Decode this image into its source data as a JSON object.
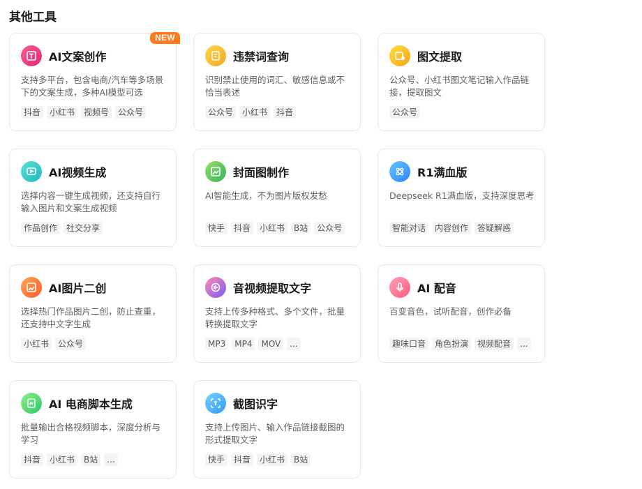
{
  "section": {
    "title": "其他工具"
  },
  "cards": [
    {
      "title": "AI文案创作",
      "desc": "支持多平台，包含电商/汽车等多场景下的文案生成，多种AI模型可选",
      "tags": [
        "抖音",
        "小红书",
        "视频号",
        "公众号"
      ],
      "badge": "NEW",
      "icon": "text-edit-icon",
      "colors": [
        "#ff5c8a",
        "#e0287a"
      ]
    },
    {
      "title": "违禁词查询",
      "desc": "识别禁止使用的词汇、敏感信息或不恰当表述",
      "tags": [
        "公众号",
        "小红书",
        "抖音"
      ],
      "icon": "document-check-icon",
      "colors": [
        "#ffd84a",
        "#f5a623"
      ]
    },
    {
      "title": "图文提取",
      "desc": "公众号、小红书图文笔记输入作品链接，提取图文",
      "tags": [
        "公众号"
      ],
      "icon": "image-extract-icon",
      "colors": [
        "#ffe03a",
        "#f7a21c"
      ]
    },
    {
      "title": "AI视频生成",
      "desc": "选择内容一键生成视频，还支持自行输入图片和文案生成视频",
      "tags": [
        "作品创作",
        "社交分享"
      ],
      "icon": "video-generate-icon",
      "colors": [
        "#5ee0d0",
        "#1fb8c4"
      ]
    },
    {
      "title": "封面图制作",
      "desc": "AI智能生成，不为图片版权发愁",
      "tags": [
        "快手",
        "抖音",
        "小红书",
        "B站",
        "公众号"
      ],
      "icon": "cover-image-icon",
      "colors": [
        "#9ae06a",
        "#33b25a"
      ]
    },
    {
      "title": "R1满血版",
      "desc": "Deepseek R1满血版，支持深度思考",
      "tags": [
        "智能对话",
        "内容创作",
        "答疑解惑"
      ],
      "icon": "atom-icon",
      "colors": [
        "#62c6ff",
        "#2f86ff"
      ]
    },
    {
      "title": "AI图片二创",
      "desc": "选择热门作品图片二创，防止查重，还支持中文字生成",
      "tags": [
        "小红书",
        "公众号"
      ],
      "icon": "image-remix-icon",
      "colors": [
        "#ffa64d",
        "#ff5a2e"
      ]
    },
    {
      "title": "音视频提取文字",
      "desc": "支持上传多种格式、多个文件，批量转换提取文字",
      "tags": [
        "MP3",
        "MP4",
        "MOV",
        "..."
      ],
      "icon": "audio-text-icon",
      "colors": [
        "#ff8ab0",
        "#7a5cf5"
      ]
    },
    {
      "title": "AI 配音",
      "desc": "百变音色，试听配音，创作必备",
      "tags": [
        "趣味口音",
        "角色扮演",
        "视频配音",
        "..."
      ],
      "icon": "microphone-icon",
      "colors": [
        "#ffa0b4",
        "#ff5c7a"
      ]
    },
    {
      "title": "AI 电商脚本生成",
      "desc": "批量输出合格视频脚本，深度分析与学习",
      "tags": [
        "抖音",
        "小红书",
        "B站",
        "..."
      ],
      "icon": "script-icon",
      "colors": [
        "#8ff08a",
        "#2cc66a"
      ]
    },
    {
      "title": "截图识字",
      "desc": "支持上传图片、输入作品链接截图的形式提取文字",
      "tags": [
        "快手",
        "抖音",
        "小红书",
        "B站"
      ],
      "icon": "screenshot-text-icon",
      "colors": [
        "#7ad0ff",
        "#2f9cf5"
      ]
    }
  ]
}
